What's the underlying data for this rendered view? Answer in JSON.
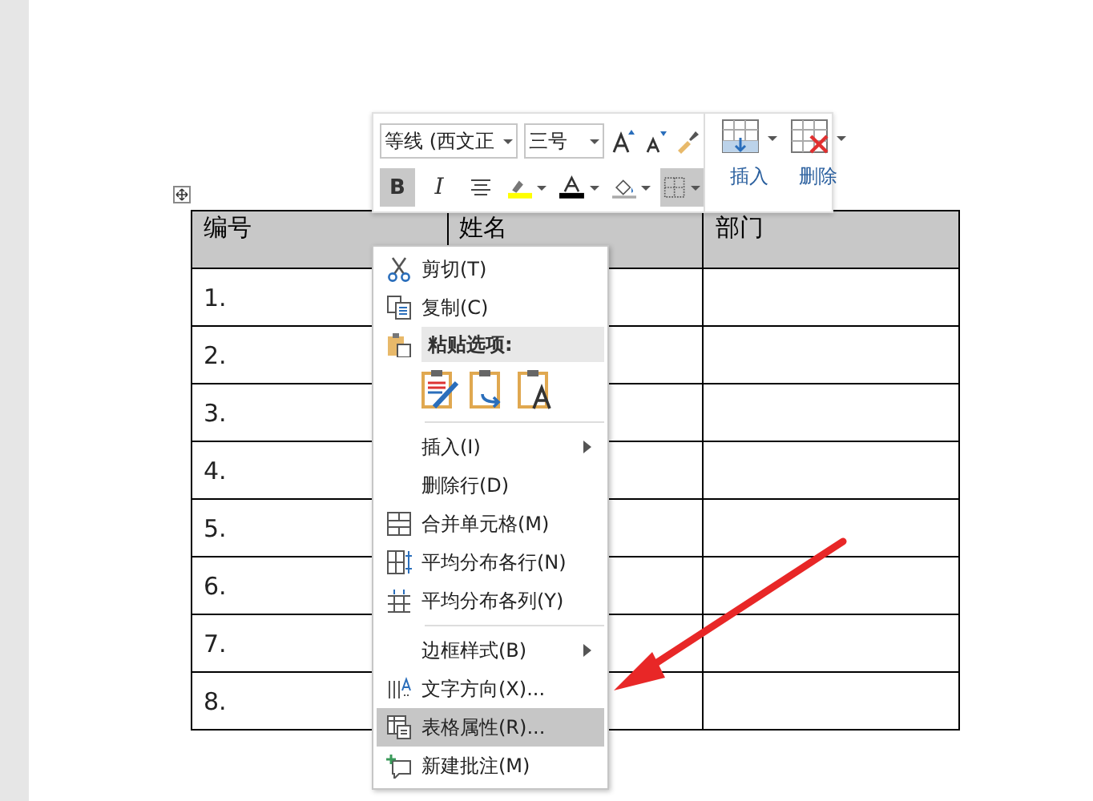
{
  "mini_toolbar": {
    "font": {
      "value": "等线 (西文正"
    },
    "size": {
      "value": "三号"
    },
    "format_buttons": [
      {
        "kind": "bold",
        "label": "B",
        "pressed": true
      },
      {
        "kind": "italic",
        "label": "I",
        "pressed": false
      },
      {
        "kind": "center",
        "pressed": false
      },
      {
        "kind": "highlight",
        "pressed": false
      },
      {
        "kind": "fontcolor",
        "pressed": false
      },
      {
        "kind": "shading",
        "pressed": false
      },
      {
        "kind": "borders",
        "pressed": true
      }
    ],
    "table_buttons": [
      {
        "kind": "insert",
        "label": "插入"
      },
      {
        "kind": "delete",
        "label": "删除"
      }
    ]
  },
  "table": {
    "columns": [
      "编号",
      "姓名",
      "部门"
    ],
    "rows": [
      {
        "number": "1."
      },
      {
        "number": "2."
      },
      {
        "number": "3."
      },
      {
        "number": "4."
      },
      {
        "number": "5."
      },
      {
        "number": "6."
      },
      {
        "number": "7."
      },
      {
        "number": "8."
      }
    ]
  },
  "context_menu": [
    {
      "kind": "item",
      "label": "剪切(T)",
      "submenu": false,
      "selected": false
    },
    {
      "kind": "item",
      "label": "复制(C)",
      "submenu": false,
      "selected": false
    },
    {
      "kind": "header",
      "label": "粘贴选项:"
    },
    {
      "kind": "paste"
    },
    {
      "kind": "separator"
    },
    {
      "kind": "item",
      "label": "插入(I)",
      "submenu": true,
      "selected": false
    },
    {
      "kind": "item",
      "label": "删除行(D)",
      "submenu": false,
      "selected": false
    },
    {
      "kind": "item",
      "label": "合并单元格(M)",
      "submenu": false,
      "selected": false
    },
    {
      "kind": "item",
      "label": "平均分布各行(N)",
      "submenu": false,
      "selected": false
    },
    {
      "kind": "item",
      "label": "平均分布各列(Y)",
      "submenu": false,
      "selected": false
    },
    {
      "kind": "separator"
    },
    {
      "kind": "item",
      "label": "边框样式(B)",
      "submenu": true,
      "selected": false
    },
    {
      "kind": "item",
      "label": "文字方向(X)...",
      "submenu": false,
      "selected": false
    },
    {
      "kind": "item",
      "label": "表格属性(R)...",
      "submenu": false,
      "selected": true
    },
    {
      "kind": "item",
      "label": "新建批注(M)",
      "submenu": false,
      "selected": false
    }
  ]
}
